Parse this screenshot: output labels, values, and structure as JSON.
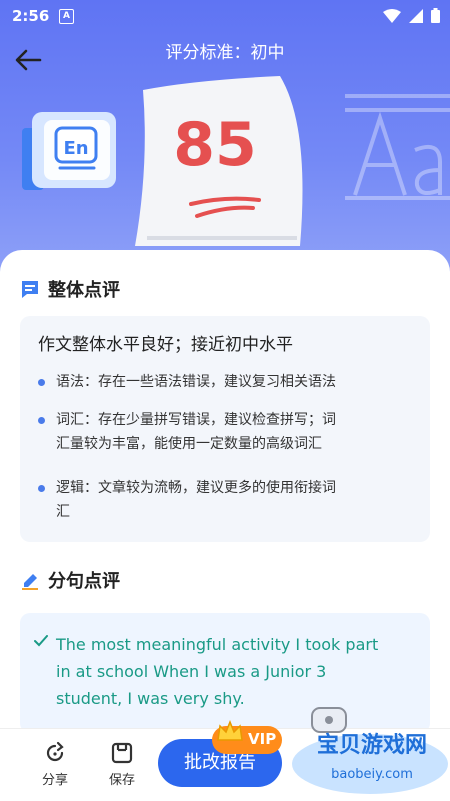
{
  "status_bar": {
    "time": "2:56",
    "notification_icon_letter": "A"
  },
  "nav": {
    "title": "评分标准：初中",
    "back_icon": "arrow-left-icon"
  },
  "hero": {
    "score": "85",
    "book_label": "En",
    "bg_letters": "Aa"
  },
  "overall": {
    "title": "整体点评",
    "summary": "作文整体水平良好；接近初中水平",
    "points": [
      {
        "line1": "语法：存在一些语法错误，建议复习相关语法",
        "line2": ""
      },
      {
        "line1": "词汇：存在少量拼写错误，建议检查拼写；词",
        "line2": "汇量较为丰富，能使用一定数量的高级词汇"
      },
      {
        "line1": "逻辑：文章较为流畅，建议更多的使用衔接词",
        "line2": "汇"
      }
    ]
  },
  "sentence": {
    "title": "分句点评",
    "lines": [
      "The most meaningful activity I took part",
      "in at school When I was a Junior 3",
      "student, I was very shy."
    ]
  },
  "bottom": {
    "share_label": "分享",
    "save_label": "保存",
    "report_label": "批改报告",
    "vip_label": "VIP"
  },
  "watermark": {
    "text": "宝贝游戏网",
    "url": "baobeiy.com"
  },
  "colors": {
    "header": "#6278f4",
    "accent": "#2c67ee",
    "score": "#e55050",
    "sentence": "#1a9a86",
    "vip": "#ff8c1a"
  }
}
